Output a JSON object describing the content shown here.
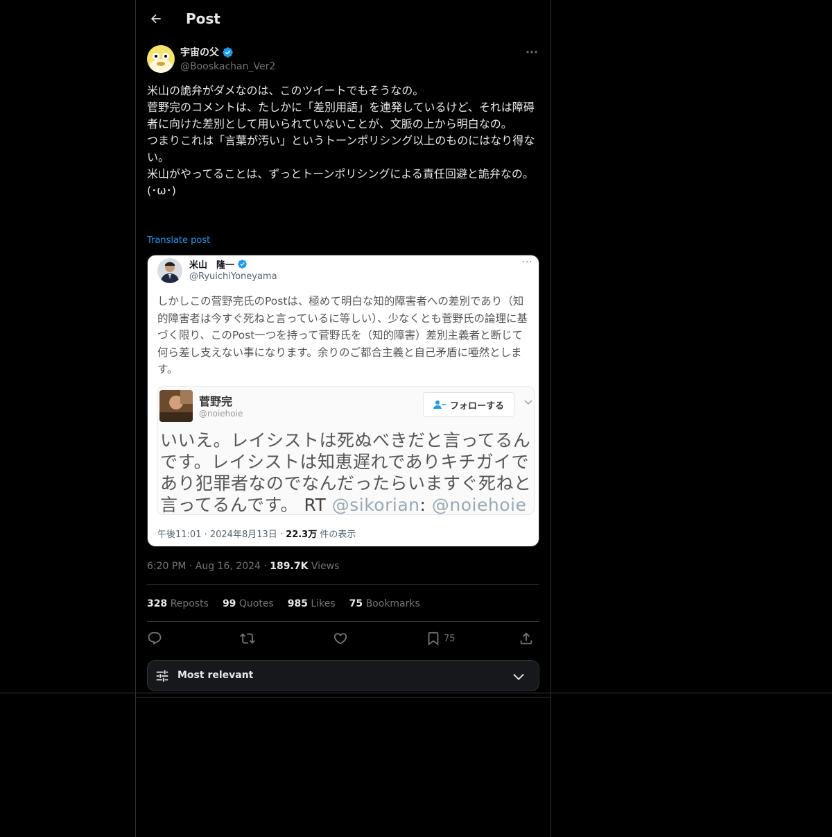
{
  "header": {
    "title": "Post"
  },
  "post": {
    "author_name": "宇宙の父",
    "author_handle": "@Booskachan_Ver2",
    "text": "米山の詭弁がダメなのは、このツイートでもそうなの。\n菅野完のコメントは、たしかに「差別用語」を連発しているけど、それは障碍者に向けた差別として用いられていないことが、文脈の上から明白なの。\nつまりこれは「言葉が汚い」というトーンポリシング以上のものにはなり得ない。\n米山がやってることは、ずっとトーンポリシングによる責任回避と詭弁なの。\n(･ω･)",
    "translate_label": "Translate post",
    "time": "6:20 PM",
    "date": "Aug 16, 2024",
    "views_count": "189.7K",
    "views_label": "Views"
  },
  "embedded": {
    "name": "米山　隆一",
    "handle": "@RyuichiYoneyama",
    "more": "···",
    "text": "しかしこの菅野完氏のPostは、極めて明白な知的障害者への差別であり（知的障害者は今すぐ死ねと言っているに等しい）、少なくとも菅野氏の論理に基づく限り、このPost一つを持って菅野氏を（知的障害）差別主義者と断じて何ら差し支えない事になります。余りのご都合主義と自己矛盾に唖然とします。",
    "quoted": {
      "name": "菅野完",
      "handle": "@noiehoie",
      "follow_label": "フォローする",
      "text": "いいえ。レイシストは死ぬべきだと言ってるんです。レイシストは知恵遅れでありキチガイであり犯罪者なのでなんだったらいますぐ死ねと言ってるんです。",
      "rt": "RT",
      "mention1": "@sikorian",
      "colon": ":",
      "mention2": "@noiehoie"
    },
    "meta_prefix": "午後11:01 · 2024年8月13日 · ",
    "meta_views": "22.3万",
    "meta_suffix": " 件の表示"
  },
  "stats": {
    "reposts_count": "328",
    "reposts_label": "Reposts",
    "quotes_count": "99",
    "quotes_label": "Quotes",
    "likes_count": "985",
    "likes_label": "Likes",
    "bookmarks_count": "75",
    "bookmarks_label": "Bookmarks"
  },
  "actions": {
    "bookmark_count": "75"
  },
  "sort": {
    "label": "Most relevant"
  },
  "colors": {
    "accent": "#1d9bf0",
    "background": "#000000",
    "muted": "#71767b",
    "text": "#e7e9ea"
  }
}
